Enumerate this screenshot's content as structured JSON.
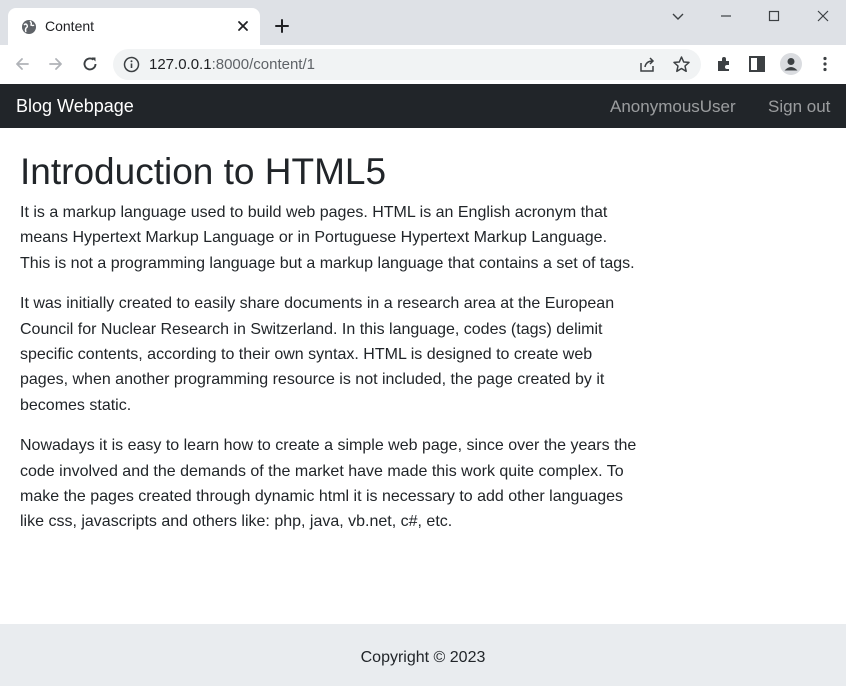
{
  "browser": {
    "tab_title": "Content",
    "url_host": "127.0.0.1",
    "url_rest": ":8000/content/1"
  },
  "navbar": {
    "brand": "Blog Webpage",
    "user": "AnonymousUser",
    "sign_out": "Sign out",
    "background": "#212529"
  },
  "article": {
    "title": "Introduction to HTML5",
    "paragraphs": [
      "It is a markup language used to build web pages. HTML is an English acronym that means Hypertext Markup Language or in Portuguese Hypertext Markup Language. This is not a programming language but a markup language that contains a set of tags.",
      "It was initially created to easily share documents in a research area at the European Council for Nuclear Research in Switzerland. In this language, codes (tags) delimit specific contents, according to their own syntax. HTML is designed to create web pages, when another programming resource is not included, the page created by it becomes static.",
      "Nowadays it is easy to learn how to create a simple web page, since over the years the code involved and the demands of the market have made this work quite complex. To make the pages created through dynamic html it is necessary to add other languages like css, javascripts and others like: php, java, vb.net, c#, etc."
    ]
  },
  "footer": {
    "copyright": "Copyright © 2023",
    "background": "#e9ecef"
  }
}
